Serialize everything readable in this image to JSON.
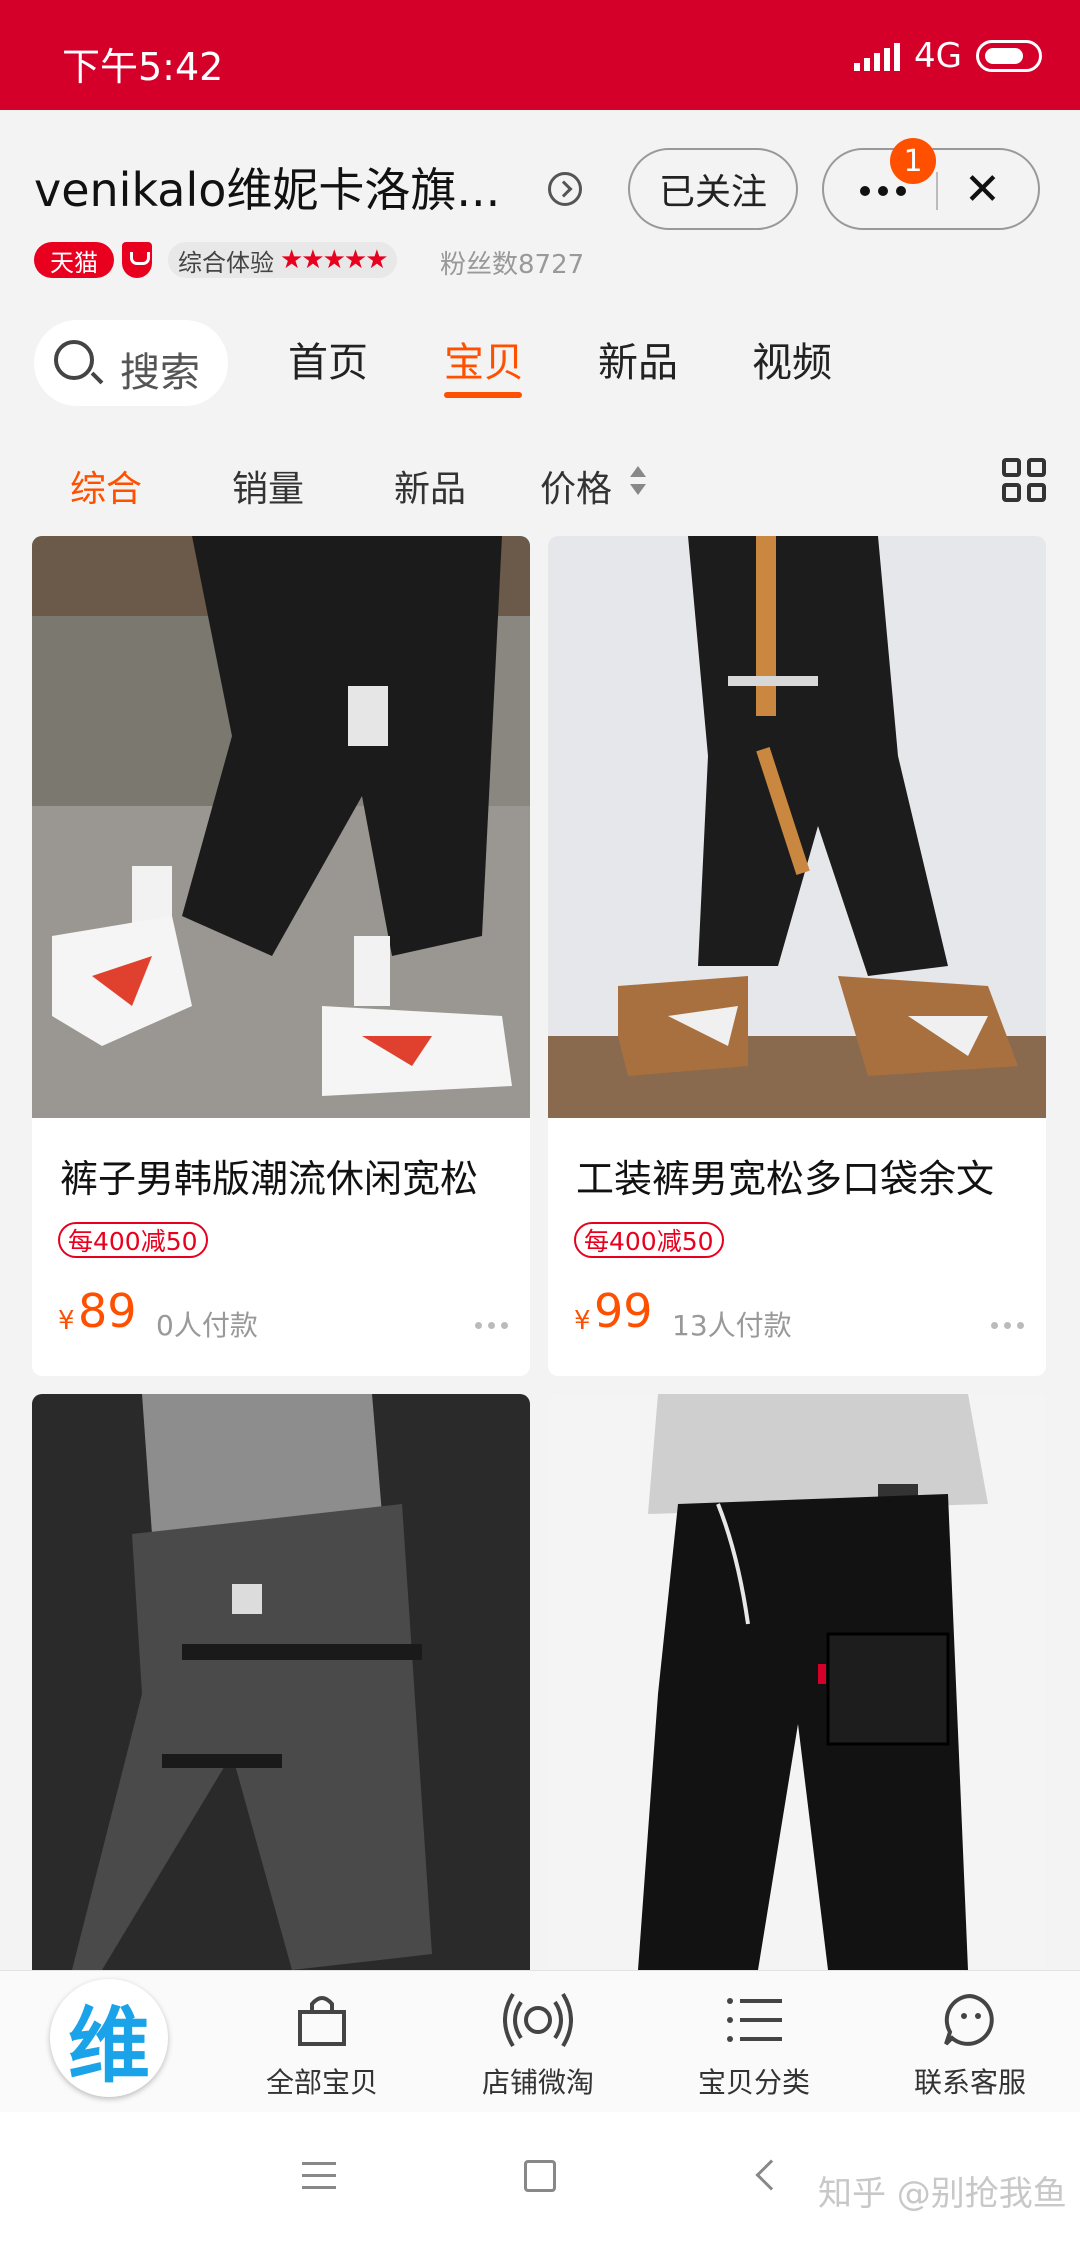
{
  "status_bar": {
    "time": "下午5:42",
    "network": "4G"
  },
  "store": {
    "name": "venikalo维妮卡洛旗...",
    "follow_label": "已关注",
    "notification_count": "1",
    "tmall_label": "天猫",
    "experience_label": "综合体验",
    "stars": "★★★★★",
    "fans": "粉丝数8727"
  },
  "nav": {
    "search_label": "搜索",
    "tabs": [
      "首页",
      "宝贝",
      "新品",
      "视频"
    ],
    "active_tab": "宝贝"
  },
  "sort": {
    "options": [
      "综合",
      "销量",
      "新品",
      "价格"
    ],
    "active": "综合"
  },
  "products": [
    {
      "title": "裤子男韩版潮流休闲宽松",
      "promo": "每400减50",
      "currency": "¥",
      "price": "89",
      "sold": "0人付款"
    },
    {
      "title": "工装裤男宽松多口袋余文",
      "promo": "每400减50",
      "currency": "¥",
      "price": "99",
      "sold": "13人付款"
    },
    {
      "title": "",
      "promo": "",
      "currency": "",
      "price": "",
      "sold": ""
    },
    {
      "title": "",
      "promo": "",
      "currency": "",
      "price": "",
      "sold": ""
    }
  ],
  "bottom_bar": {
    "logo_text": "维",
    "items": [
      {
        "label": "全部宝贝",
        "icon": "bag-icon"
      },
      {
        "label": "店铺微淘",
        "icon": "broadcast-icon"
      },
      {
        "label": "宝贝分类",
        "icon": "list-icon"
      },
      {
        "label": "联系客服",
        "icon": "chat-face-icon"
      }
    ]
  },
  "watermark": "知乎 @别抢我鱼",
  "colors": {
    "status_bar": "#d4002a",
    "accent": "#ff5000",
    "tmall_red": "#e8001e"
  }
}
